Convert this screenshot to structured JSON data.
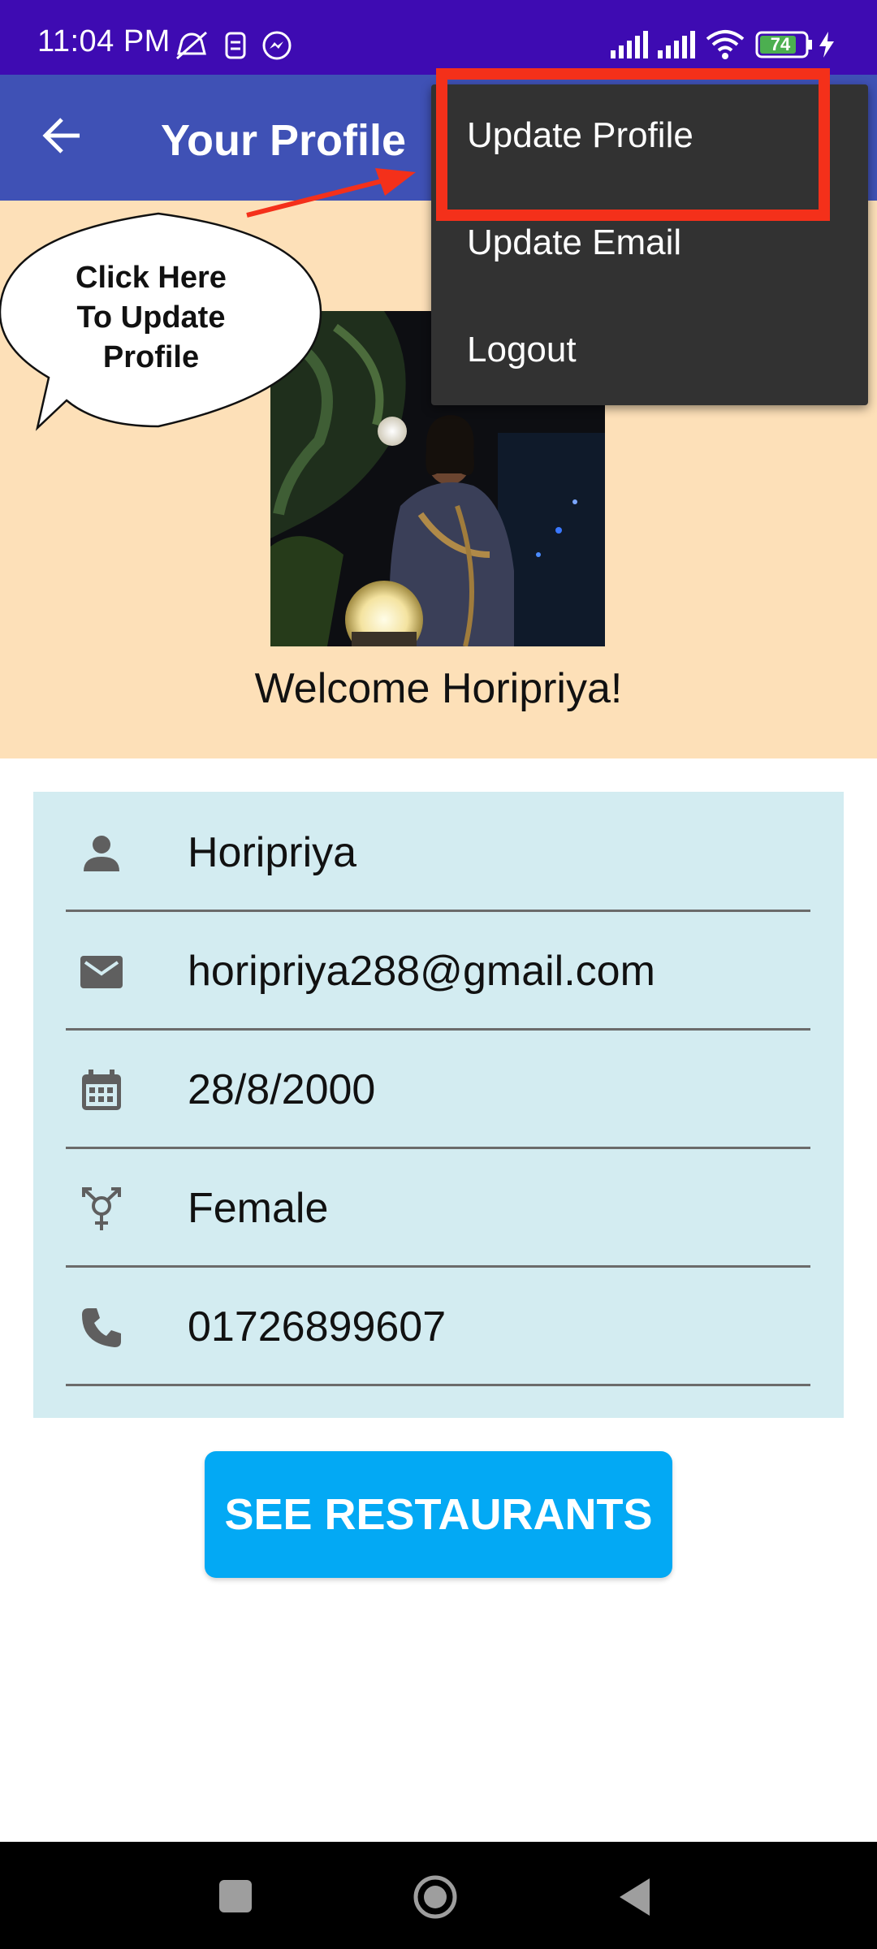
{
  "status_bar": {
    "time": "11:04 PM",
    "battery_level": "74",
    "icons": [
      "mute-alarm-icon",
      "sim-icon",
      "messenger-icon",
      "signal-icon",
      "signal-icon",
      "wifi-icon",
      "battery-icon",
      "charging-icon"
    ]
  },
  "app_bar": {
    "back_icon": "arrow-left-icon",
    "title": "Your Profile"
  },
  "annotation": {
    "bubble_text_line1": "Click Here",
    "bubble_text_line2": "To Update",
    "bubble_text_line3": "Profile",
    "highlight_color": "#f4301a"
  },
  "menu": {
    "items": [
      {
        "label": "Update Profile"
      },
      {
        "label": "Update Email"
      },
      {
        "label": "Logout"
      }
    ]
  },
  "header": {
    "welcome": "Welcome Horipriya!"
  },
  "profile": {
    "name": "Horipriya",
    "email": "horipriya288@gmail.com",
    "dob": "28/8/2000",
    "gender": "Female",
    "phone": "01726899607"
  },
  "button": {
    "label": "SEE RESTAURANTS"
  },
  "colors": {
    "status_bar": "#3e0bb2",
    "app_bar": "#3f51b5",
    "header_bg": "#fde0b8",
    "card_bg": "#d3ecf1",
    "button": "#03a9f4",
    "menu_bg": "#323232"
  }
}
